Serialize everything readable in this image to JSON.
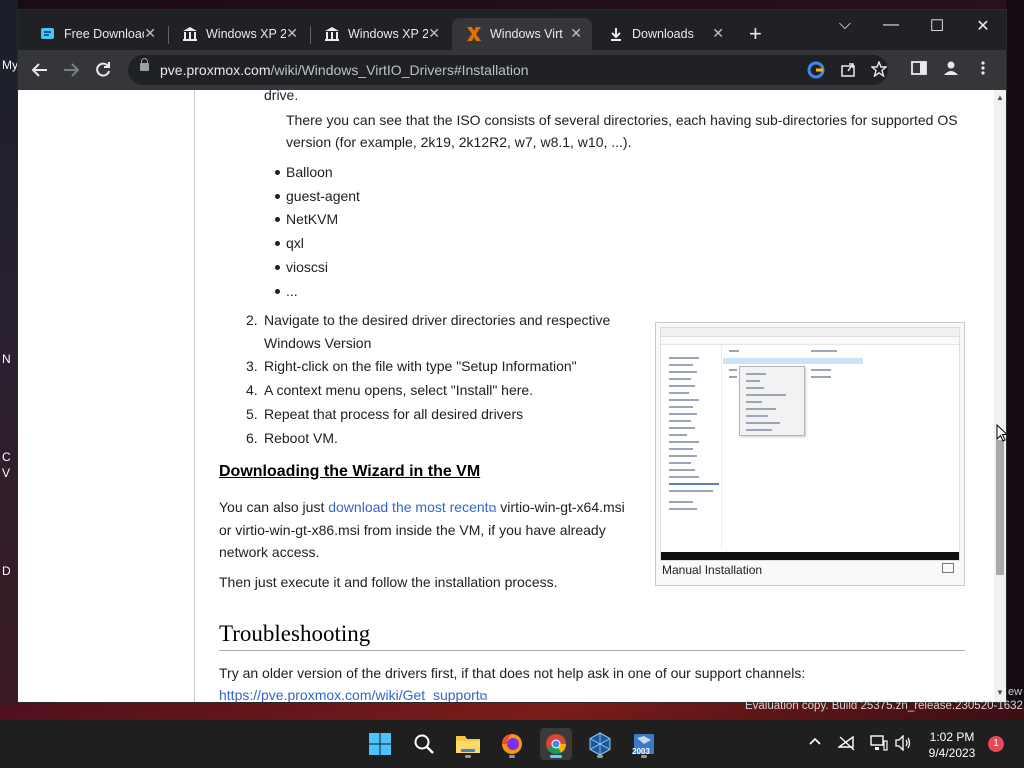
{
  "desktop": {
    "left_fragments": [
      "My",
      "N",
      "C",
      "V",
      "D"
    ],
    "right_fragment": "ew"
  },
  "browser": {
    "tabs": [
      {
        "label": "Free Download",
        "icon": "download-page-icon"
      },
      {
        "label": "Windows XP 2",
        "icon": "archive-icon"
      },
      {
        "label": "Windows XP 2",
        "icon": "archive-icon"
      },
      {
        "label": "Windows Virt",
        "icon": "proxmox-icon",
        "active": true
      },
      {
        "label": "Downloads",
        "icon": "download-icon"
      }
    ],
    "close_glyph": "✕",
    "new_tab_glyph": "+",
    "window_controls": {
      "dropdown": "⌵",
      "minimize": "—",
      "maximize": "☐",
      "close": "✕"
    },
    "url": {
      "host": "pve.proxmox.com",
      "path": "/wiki/Windows_VirtIO_Drivers#Installation"
    }
  },
  "article": {
    "drive_line": "drive.",
    "iso_text": "There you can see that the ISO consists of several directories, each having sub-directories for supported OS",
    "iso_text_2": "version (for example, 2k19, 2k12R2, w7, w8.1, w10, ...).",
    "bullets": [
      "Balloon",
      "guest-agent",
      "NetKVM",
      "qxl",
      "vioscsi",
      "..."
    ],
    "steps": [
      {
        "num": "2.",
        "text": "Navigate to the desired driver directories and respective"
      },
      {
        "num": "",
        "text": "Windows Version"
      },
      {
        "num": "3.",
        "text": "Right-click on the file with type \"Setup Information\""
      },
      {
        "num": "4.",
        "text": "A context menu opens, select \"Install\" here."
      },
      {
        "num": "5.",
        "text": "Repeat that process for all desired drivers"
      },
      {
        "num": "6.",
        "text": "Reboot VM."
      }
    ],
    "wizard_heading": "Downloading the Wizard in the VM",
    "wizard_p1_pre": "You can also just ",
    "wizard_p1_link": "download the most recent",
    "wizard_p1_post": " virtio-win-gt-x64.msi",
    "wizard_p1_line2": "or virtio-win-gt-x86.msi from inside the VM, if you have already",
    "wizard_p1_line3": "network access.",
    "wizard_p2": "Then just execute it and follow the installation process.",
    "figure_caption": "Manual Installation",
    "troubleshooting_heading": "Troubleshooting",
    "trouble_text": "Try an older version of the drivers first, if that does not help ask in one of our support channels:",
    "trouble_link": "https://pve.proxmox.com/wiki/Get_support"
  },
  "watermark": "Evaluation copy. Build 25375.zn_release.230520-1632",
  "taskbar": {
    "time": "1:02 PM",
    "date": "9/4/2023",
    "notification_count": "1",
    "app_badge": "2003"
  }
}
